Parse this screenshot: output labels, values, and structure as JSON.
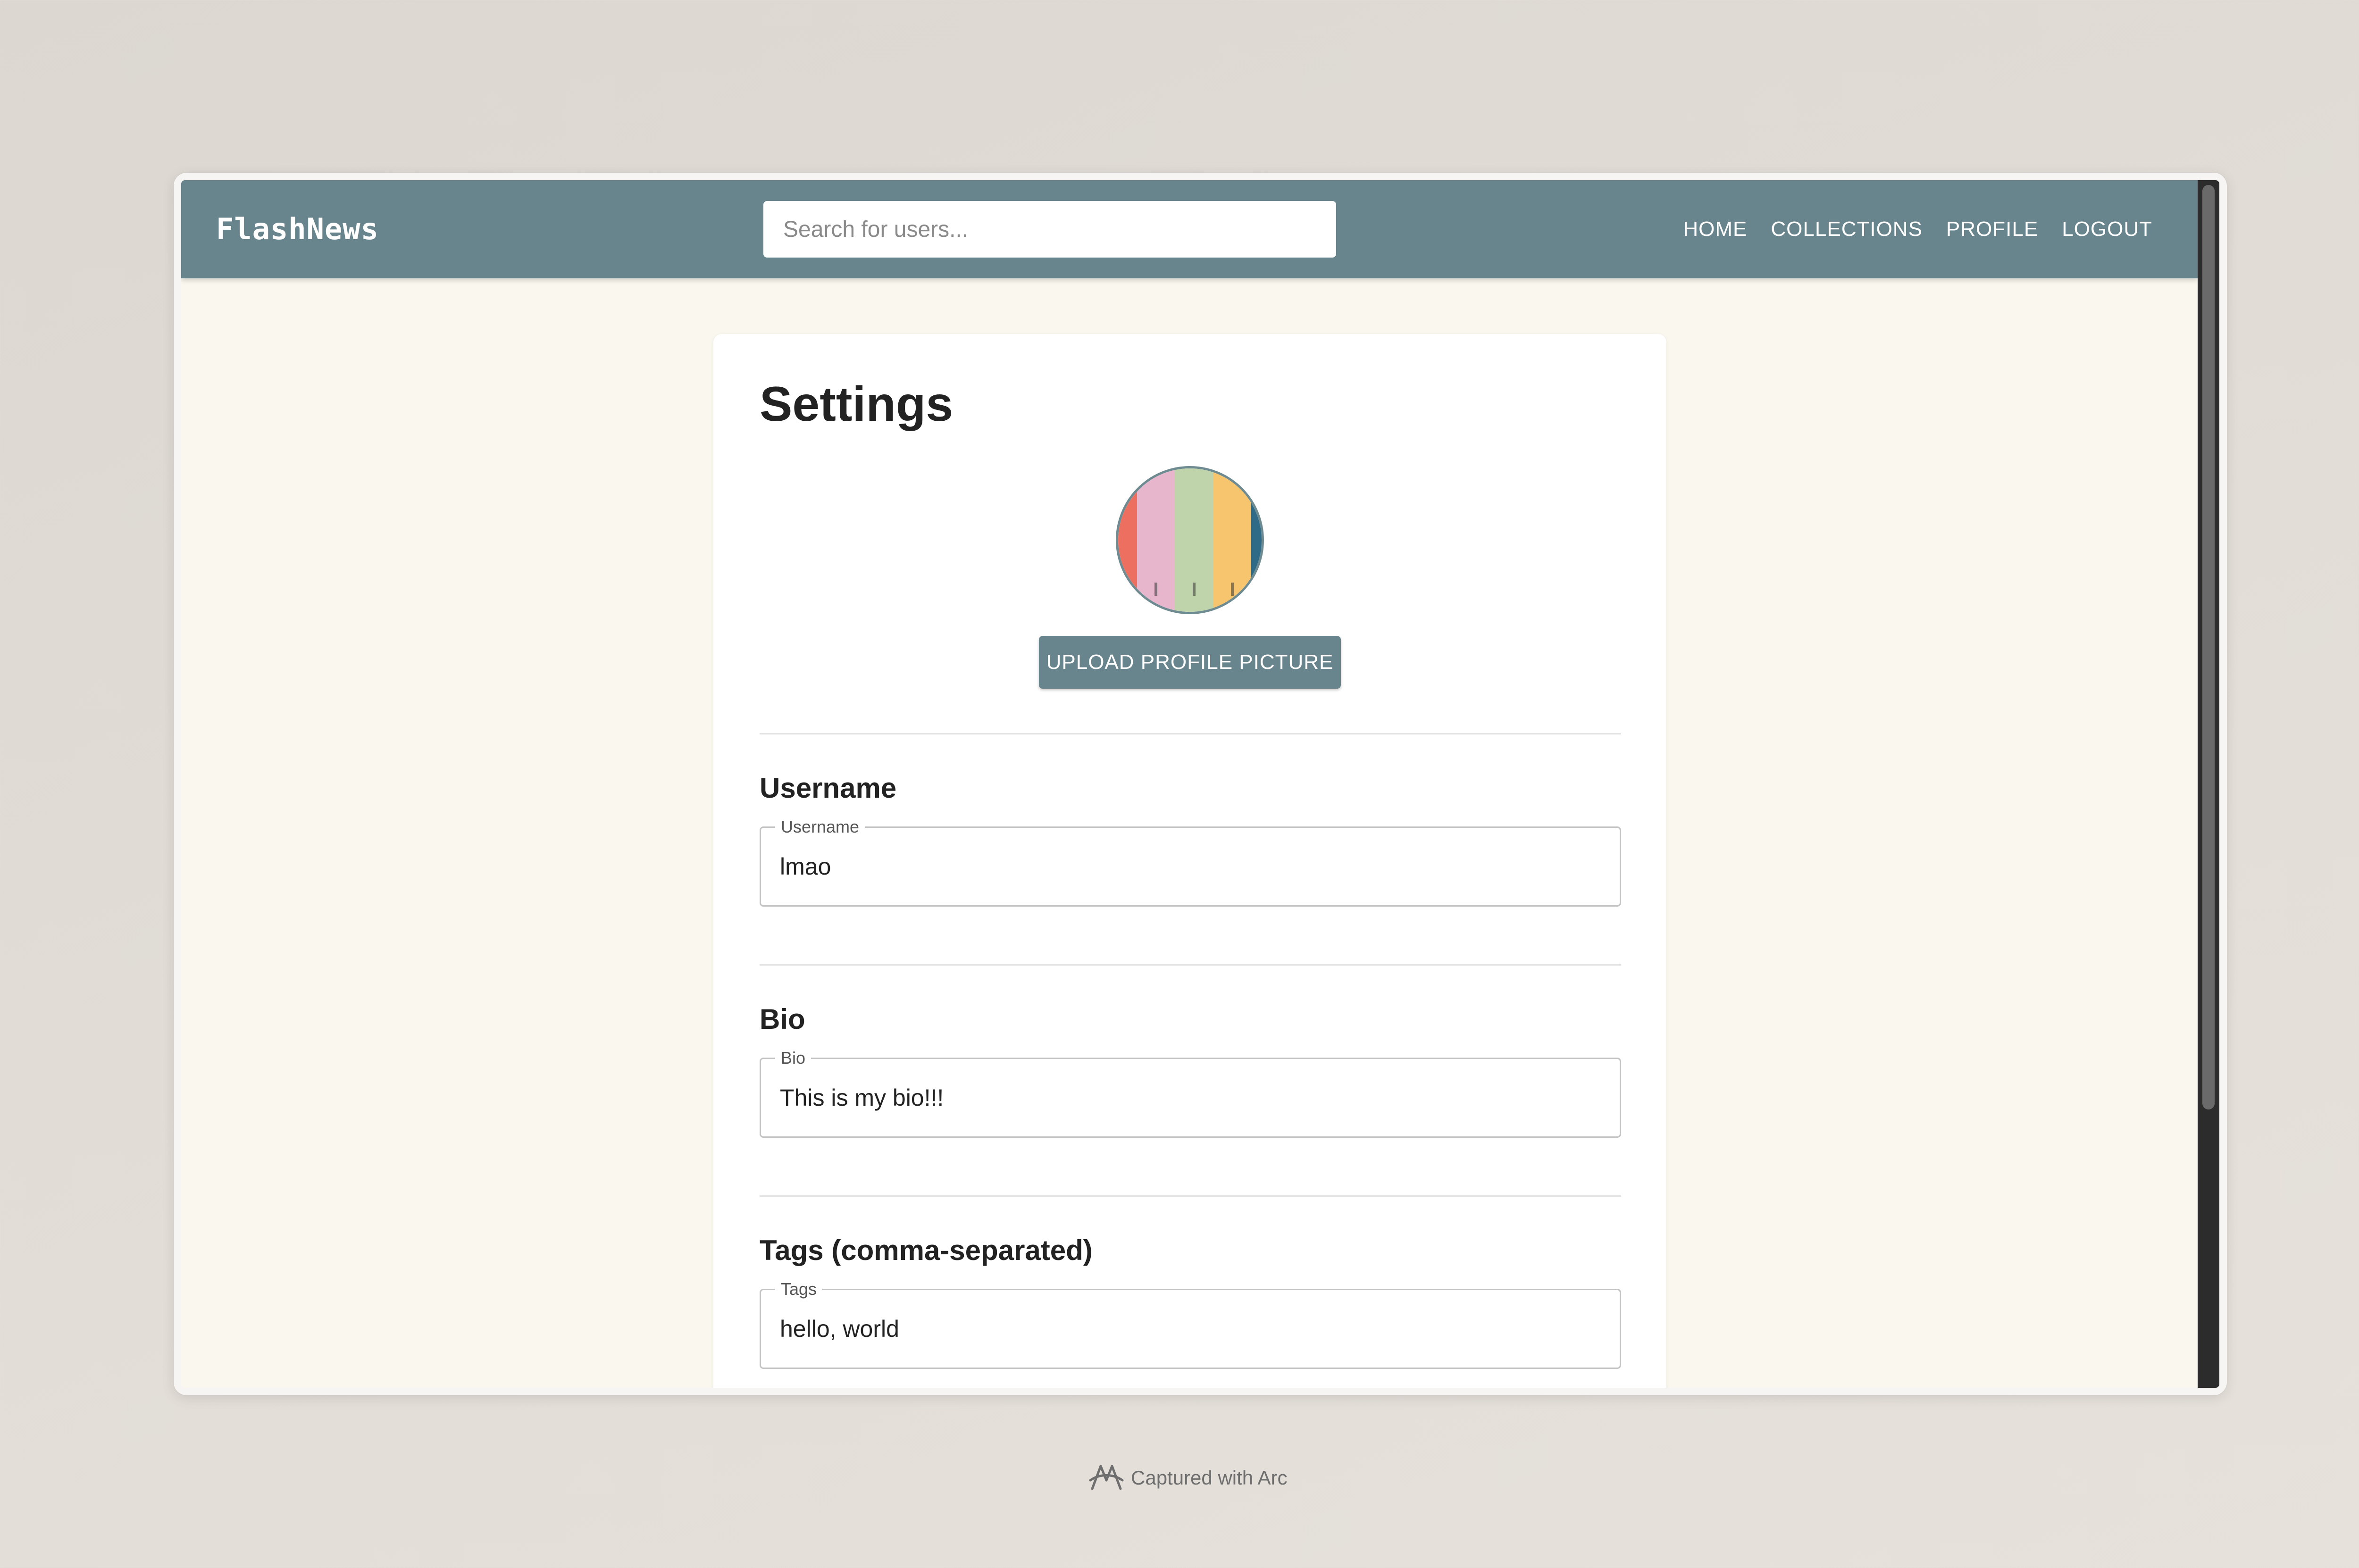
{
  "app": {
    "brand": "FlashNews"
  },
  "search": {
    "placeholder": "Search for users..."
  },
  "nav": {
    "links": [
      "HOME",
      "COLLECTIONS",
      "PROFILE",
      "LOGOUT"
    ]
  },
  "settings": {
    "title": "Settings",
    "upload_button": "UPLOAD PROFILE PICTURE",
    "username": {
      "section_label": "Username",
      "field_label": "Username",
      "value": "lmao"
    },
    "bio": {
      "section_label": "Bio",
      "field_label": "Bio",
      "value": "This is my bio!!!"
    },
    "tags": {
      "section_label": "Tags (comma-separated)",
      "field_label": "Tags",
      "value": "hello, world"
    }
  },
  "avatar_colors": [
    "#ec6f5f",
    "#e7b5cc",
    "#bfd4aa",
    "#f6c56e",
    "#2f6b86"
  ],
  "theme": {
    "navbar": "#68858d",
    "page_background": "#faf8ee",
    "card": "#ffffff"
  },
  "footer": {
    "caption": "Captured with Arc",
    "icon": "arc-logo-icon"
  }
}
